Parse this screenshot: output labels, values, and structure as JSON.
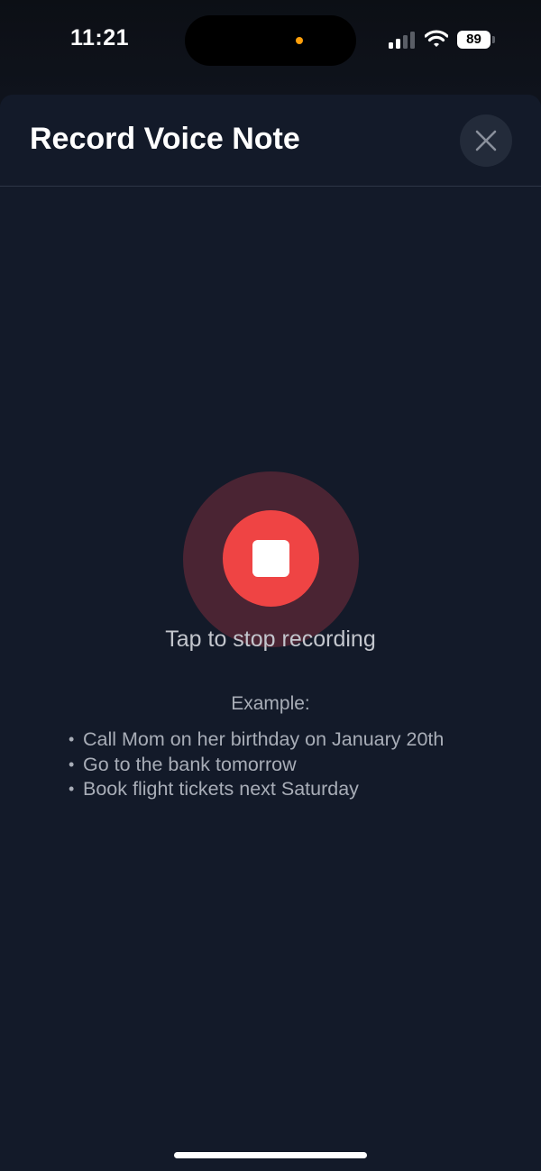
{
  "status_bar": {
    "time": "11:21",
    "battery": "89",
    "privacy_indicator_color": "#ff9f0a",
    "icons": [
      "signal-icon",
      "wifi-icon",
      "battery-icon"
    ]
  },
  "sheet": {
    "title": "Record Voice Note",
    "close_icon": "close-icon"
  },
  "recorder": {
    "state": "recording",
    "stop_icon": "stop-icon",
    "accent_color": "#ef4444",
    "instruction": "Tap to stop recording"
  },
  "examples": {
    "label": "Example:",
    "bullet": "•",
    "items": [
      "Call Mom on her birthday on January 20th",
      "Go to the bank tomorrow",
      "Book flight tickets next Saturday"
    ]
  }
}
